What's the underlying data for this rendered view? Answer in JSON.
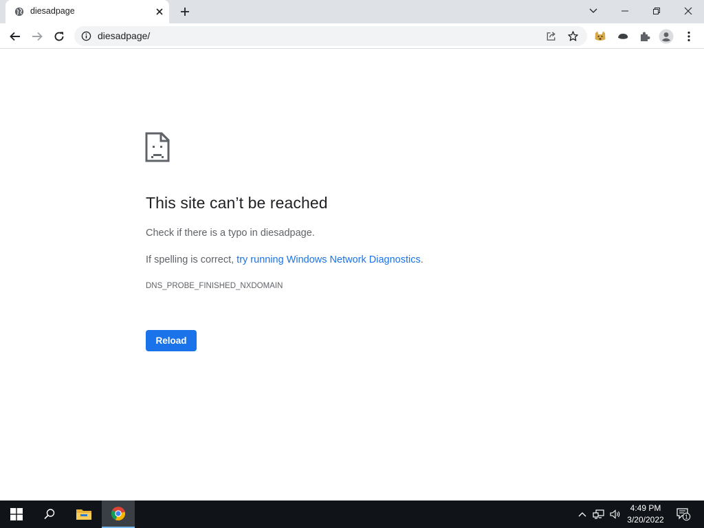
{
  "browser": {
    "tab": {
      "title": "diesadpage",
      "favicon": "globe-icon"
    },
    "address": {
      "url": "diesadpage/"
    },
    "window_controls": [
      "chevron-down-icon",
      "minimize-icon",
      "restore-icon",
      "close-icon"
    ]
  },
  "page": {
    "heading": "This site can’t be reached",
    "line1": "Check if there is a typo in diesadpage.",
    "line2_prefix": "If spelling is correct, ",
    "line2_link": "try running Windows Network Diagnostics",
    "line2_suffix": ".",
    "error_code": "DNS_PROBE_FINISHED_NXDOMAIN",
    "reload_label": "Reload"
  },
  "taskbar": {
    "time": "4:49 PM",
    "date": "3/20/2022",
    "notification_count": "1"
  },
  "colors": {
    "link": "#1a73e8",
    "button": "#1a73e8",
    "tabstrip": "#dee1e6",
    "taskbar": "#101418"
  }
}
